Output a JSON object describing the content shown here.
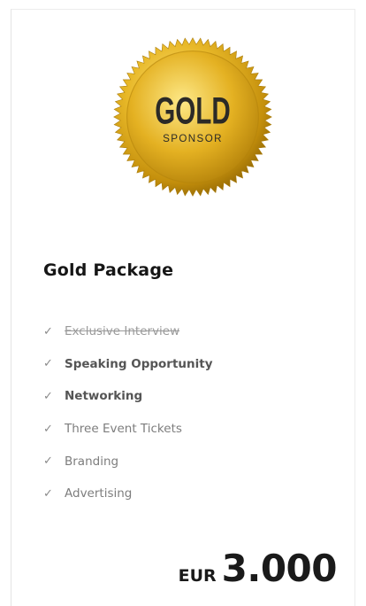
{
  "package": {
    "badge": {
      "icon": "gold-sponsor-seal-icon",
      "main_text": "GOLD",
      "sub_text": "SPONSOR",
      "colors": {
        "gold_light": "#f7d24a",
        "gold_mid": "#d9a91a",
        "gold_dark": "#9a6f06",
        "text": "#2b2a27"
      }
    },
    "title": "Gold Package",
    "features": [
      {
        "label": "Exclusive Interview",
        "style": "strikethrough",
        "icon": "checkmark-icon"
      },
      {
        "label": "Speaking Opportunity",
        "style": "bold",
        "icon": "checkmark-icon"
      },
      {
        "label": "Networking",
        "style": "bold",
        "icon": "checkmark-icon"
      },
      {
        "label": "Three Event Tickets",
        "style": "normal",
        "icon": "checkmark-icon"
      },
      {
        "label": "Branding",
        "style": "normal",
        "icon": "checkmark-icon"
      },
      {
        "label": "Advertising",
        "style": "normal",
        "icon": "checkmark-icon"
      }
    ],
    "check_glyph": "✓",
    "price": {
      "currency": "EUR",
      "amount": "3.000"
    }
  }
}
